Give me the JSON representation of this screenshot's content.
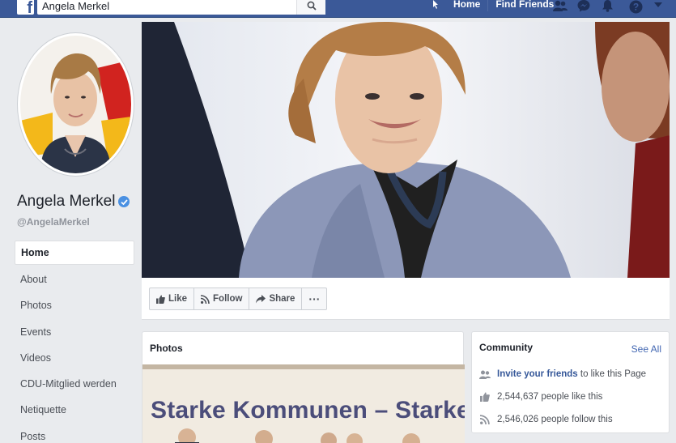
{
  "topbar": {
    "search_value": "Angela Merkel",
    "nav": [
      {
        "label": "Home"
      },
      {
        "label": "Find Friends"
      }
    ],
    "icons": [
      "friend-requests-icon",
      "messenger-icon",
      "notifications-icon",
      "help-icon",
      "chevron-down-icon"
    ]
  },
  "page": {
    "name": "Angela Merkel",
    "handle": "@AngelaMerkel"
  },
  "sidebar": {
    "items": [
      {
        "label": "Home"
      },
      {
        "label": "About"
      },
      {
        "label": "Photos"
      },
      {
        "label": "Events"
      },
      {
        "label": "Videos"
      },
      {
        "label": "CDU-Mitglied werden"
      },
      {
        "label": "Netiquette"
      },
      {
        "label": "Posts"
      }
    ]
  },
  "actions": {
    "like": "Like",
    "follow": "Follow",
    "share": "Share",
    "more": "···"
  },
  "photos": {
    "title": "Photos",
    "slogan": "Starke Kommunen – Starkes De"
  },
  "community": {
    "title": "Community",
    "see_all": "See All",
    "invite_link": "Invite your friends",
    "invite_rest": " to like this Page",
    "likes": "2,544,637 people like this",
    "follows": "2,546,026 people follow this"
  },
  "colors": {
    "brand": "#3b5998",
    "link": "#365899",
    "verified": "#4a90e2"
  }
}
